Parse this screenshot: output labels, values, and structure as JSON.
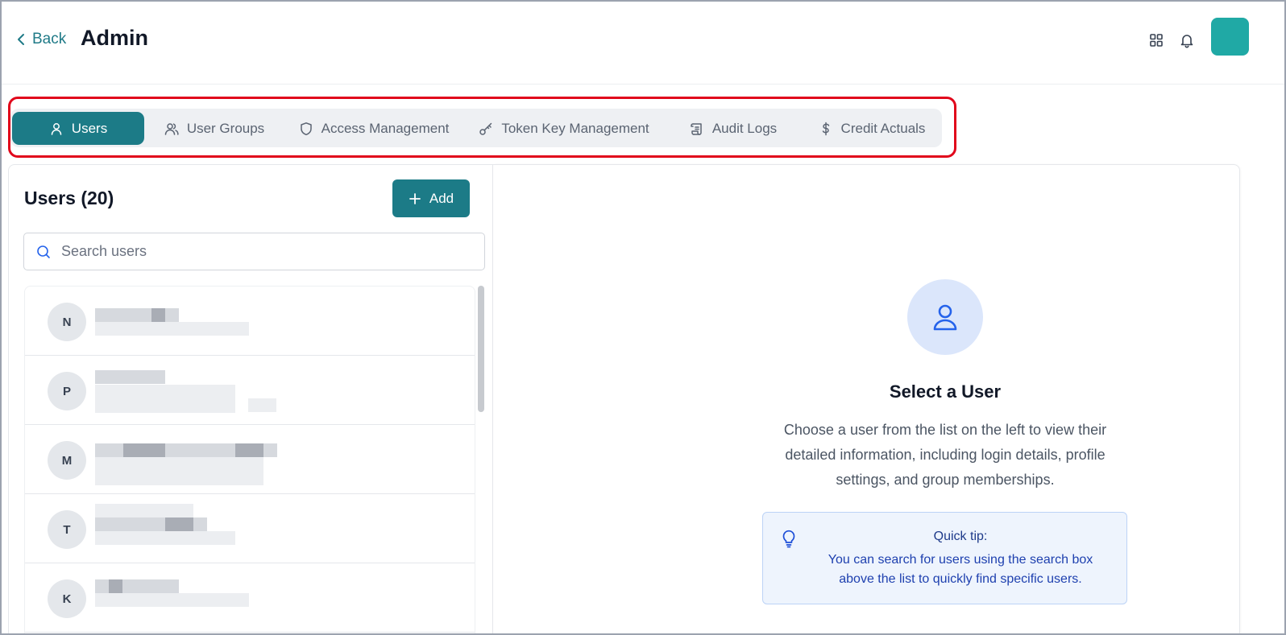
{
  "header": {
    "back_label": "Back",
    "title": "Admin"
  },
  "tabs": [
    {
      "label": "Users",
      "icon": "user-icon",
      "active": true
    },
    {
      "label": "User Groups",
      "icon": "users-icon",
      "active": false
    },
    {
      "label": "Access Management",
      "icon": "shield-icon",
      "active": false
    },
    {
      "label": "Token Key Management",
      "icon": "key-icon",
      "active": false
    },
    {
      "label": "Audit Logs",
      "icon": "scroll-icon",
      "active": false
    },
    {
      "label": "Credit Actuals",
      "icon": "dollar-icon",
      "active": false
    }
  ],
  "users_panel": {
    "title": "Users (20)",
    "add_label": "Add",
    "search_placeholder": "Search users",
    "items": [
      {
        "initial": "N"
      },
      {
        "initial": "P"
      },
      {
        "initial": "M"
      },
      {
        "initial": "T"
      },
      {
        "initial": "K"
      }
    ]
  },
  "detail_panel": {
    "empty_title": "Select a User",
    "empty_description": "Choose a user from the list on the left to view their detailed information, including login details, profile settings, and group memberships.",
    "tip_title": "Quick tip:",
    "tip_text": "You can search for users using the search box above the list to quickly find specific users."
  },
  "colors": {
    "accent": "#1c7b87",
    "highlight": "#e1061b",
    "avatar_button": "#20a9a5"
  }
}
